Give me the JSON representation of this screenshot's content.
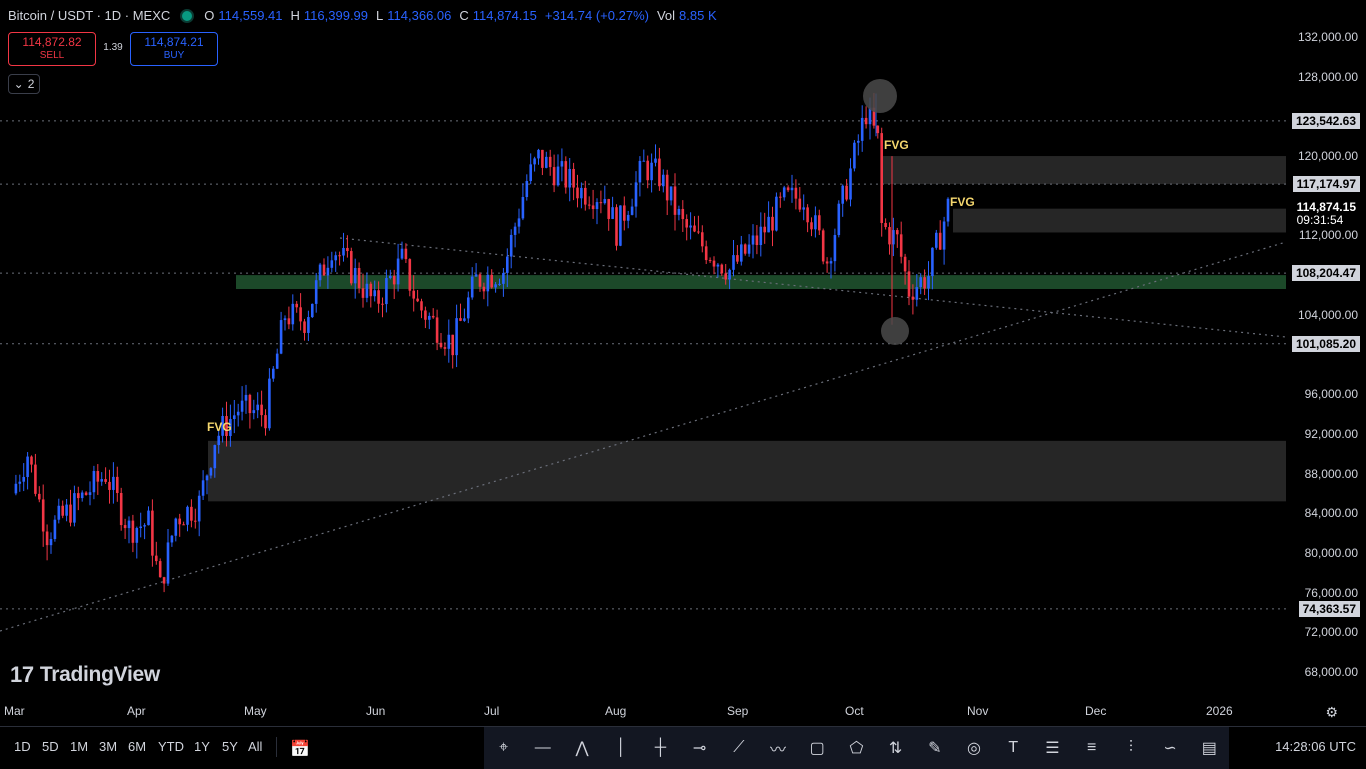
{
  "header": {
    "symbol": "Bitcoin / USDT · 1D · MEXC",
    "o_label": "O",
    "o_value": "114,559.41",
    "h_label": "H",
    "h_value": "116,399.99",
    "l_label": "L",
    "l_value": "114,366.06",
    "c_label": "C",
    "c_value": "114,874.15",
    "change": "+314.74 (+0.27%)",
    "vol_label": "Vol",
    "vol_value": "8.85 K"
  },
  "trade": {
    "sell_price": "114,872.82",
    "sell_label": "SELL",
    "spread": "1.39",
    "buy_price": "114,874.21",
    "buy_label": "BUY"
  },
  "collapse": {
    "count": "2"
  },
  "logo": {
    "text": "TradingView",
    "mark": "17"
  },
  "price_axis": [
    "132,000.00",
    "128,000.00",
    "120,000.00",
    "112,000.00",
    "104,000.00",
    "96,000.00",
    "92,000.00",
    "88,000.00",
    "84,000.00",
    "80,000.00",
    "76,000.00",
    "72,000.00",
    "68,000.00"
  ],
  "price_axis_values": [
    132000,
    128000,
    120000,
    112000,
    104000,
    96000,
    92000,
    88000,
    84000,
    80000,
    76000,
    72000,
    68000
  ],
  "level_tags": [
    {
      "label": "123,542.63",
      "value": 123542.63
    },
    {
      "label": "117,174.97",
      "value": 117174.97
    },
    {
      "label": "108,204.47",
      "value": 108204.47
    },
    {
      "label": "101,085.20",
      "value": 101085.2
    },
    {
      "label": "74,363.57",
      "value": 74363.57
    }
  ],
  "last_price": {
    "label": "114,874.15",
    "countdown": "09:31:54",
    "value": 114874.15
  },
  "time_axis": [
    "Mar",
    "Apr",
    "May",
    "Jun",
    "Jul",
    "Aug",
    "Sep",
    "Oct",
    "Nov",
    "Dec",
    "2026"
  ],
  "annotations": {
    "fvg": "FVG"
  },
  "range_buttons": [
    "1D",
    "5D",
    "1M",
    "3M",
    "6M",
    "YTD",
    "1Y",
    "5Y",
    "All"
  ],
  "drawing_tools": [
    "cursor-cross-icon",
    "horizontal-line-icon",
    "pattern-icon",
    "vertical-line-icon",
    "cross-line-icon",
    "horizontal-ray-icon",
    "trend-line-icon",
    "path-icon",
    "rectangle-icon",
    "polygon-icon",
    "long-position-icon",
    "brush-icon",
    "circle-icon",
    "text-icon",
    "fib-retracement-icon",
    "fib-extension-icon",
    "pitchfork-icon",
    "curve-icon",
    "volume-profile-icon"
  ],
  "clock": "14:28:06 UTC",
  "colors": {
    "up": "#2962ff",
    "down": "#f23645",
    "zone": "#2a2a2a",
    "support": "#1e4d2b",
    "fvg": "#f5d76e"
  },
  "chart_data": {
    "type": "candlestick",
    "title": "Bitcoin / USDT · 1D · MEXC",
    "xlabel": "",
    "ylabel": "",
    "ylim": [
      66000,
      134000
    ],
    "x": [
      "Mar",
      "Apr",
      "May",
      "Jun",
      "Jul",
      "Aug",
      "Sep",
      "Oct",
      "Nov",
      "Dec",
      "2026"
    ],
    "close_path": [
      {
        "date": "2025-03-01",
        "close": 86000
      },
      {
        "date": "2025-03-05",
        "close": 90000
      },
      {
        "date": "2025-03-10",
        "close": 82000
      },
      {
        "date": "2025-03-15",
        "close": 84000
      },
      {
        "date": "2025-03-20",
        "close": 86000
      },
      {
        "date": "2025-03-25",
        "close": 88000
      },
      {
        "date": "2025-03-31",
        "close": 82500
      },
      {
        "date": "2025-04-05",
        "close": 83000
      },
      {
        "date": "2025-04-08",
        "close": 76500
      },
      {
        "date": "2025-04-12",
        "close": 83500
      },
      {
        "date": "2025-04-18",
        "close": 85000
      },
      {
        "date": "2025-04-22",
        "close": 91500
      },
      {
        "date": "2025-04-28",
        "close": 94500
      },
      {
        "date": "2025-05-05",
        "close": 94000
      },
      {
        "date": "2025-05-10",
        "close": 104000
      },
      {
        "date": "2025-05-15",
        "close": 103500
      },
      {
        "date": "2025-05-22",
        "close": 111000
      },
      {
        "date": "2025-05-28",
        "close": 108000
      },
      {
        "date": "2025-06-02",
        "close": 105000
      },
      {
        "date": "2025-06-09",
        "close": 109500
      },
      {
        "date": "2025-06-13",
        "close": 105000
      },
      {
        "date": "2025-06-22",
        "close": 101000
      },
      {
        "date": "2025-06-28",
        "close": 107500
      },
      {
        "date": "2025-07-05",
        "close": 108500
      },
      {
        "date": "2025-07-11",
        "close": 117500
      },
      {
        "date": "2025-07-14",
        "close": 119800
      },
      {
        "date": "2025-07-20",
        "close": 118000
      },
      {
        "date": "2025-07-25",
        "close": 116500
      },
      {
        "date": "2025-07-31",
        "close": 116000
      },
      {
        "date": "2025-08-03",
        "close": 112500
      },
      {
        "date": "2025-08-10",
        "close": 119000
      },
      {
        "date": "2025-08-14",
        "close": 118000
      },
      {
        "date": "2025-08-20",
        "close": 113000
      },
      {
        "date": "2025-08-25",
        "close": 111000
      },
      {
        "date": "2025-09-01",
        "close": 108500
      },
      {
        "date": "2025-09-08",
        "close": 111500
      },
      {
        "date": "2025-09-15",
        "close": 115500
      },
      {
        "date": "2025-09-20",
        "close": 116000
      },
      {
        "date": "2025-09-26",
        "close": 109500
      },
      {
        "date": "2025-10-01",
        "close": 117000
      },
      {
        "date": "2025-10-06",
        "close": 124500
      },
      {
        "date": "2025-10-09",
        "close": 121500
      },
      {
        "date": "2025-10-10",
        "close": 113000
      },
      {
        "date": "2025-10-14",
        "close": 111500
      },
      {
        "date": "2025-10-17",
        "close": 106500
      },
      {
        "date": "2025-10-22",
        "close": 108000
      },
      {
        "date": "2025-10-27",
        "close": 114874.15
      }
    ],
    "zones": [
      {
        "name": "fvg-upper",
        "from": 117174.97,
        "to": 120000
      },
      {
        "name": "fvg-lower",
        "from": 112300,
        "to": 114700
      },
      {
        "name": "fvg-april",
        "from": 85200,
        "to": 91300
      },
      {
        "name": "support-green",
        "from": 106600,
        "to": 108000
      }
    ],
    "dotted_levels": [
      123542.63,
      117174.97,
      108204.47,
      101085.2,
      74363.57
    ],
    "grid": false
  }
}
